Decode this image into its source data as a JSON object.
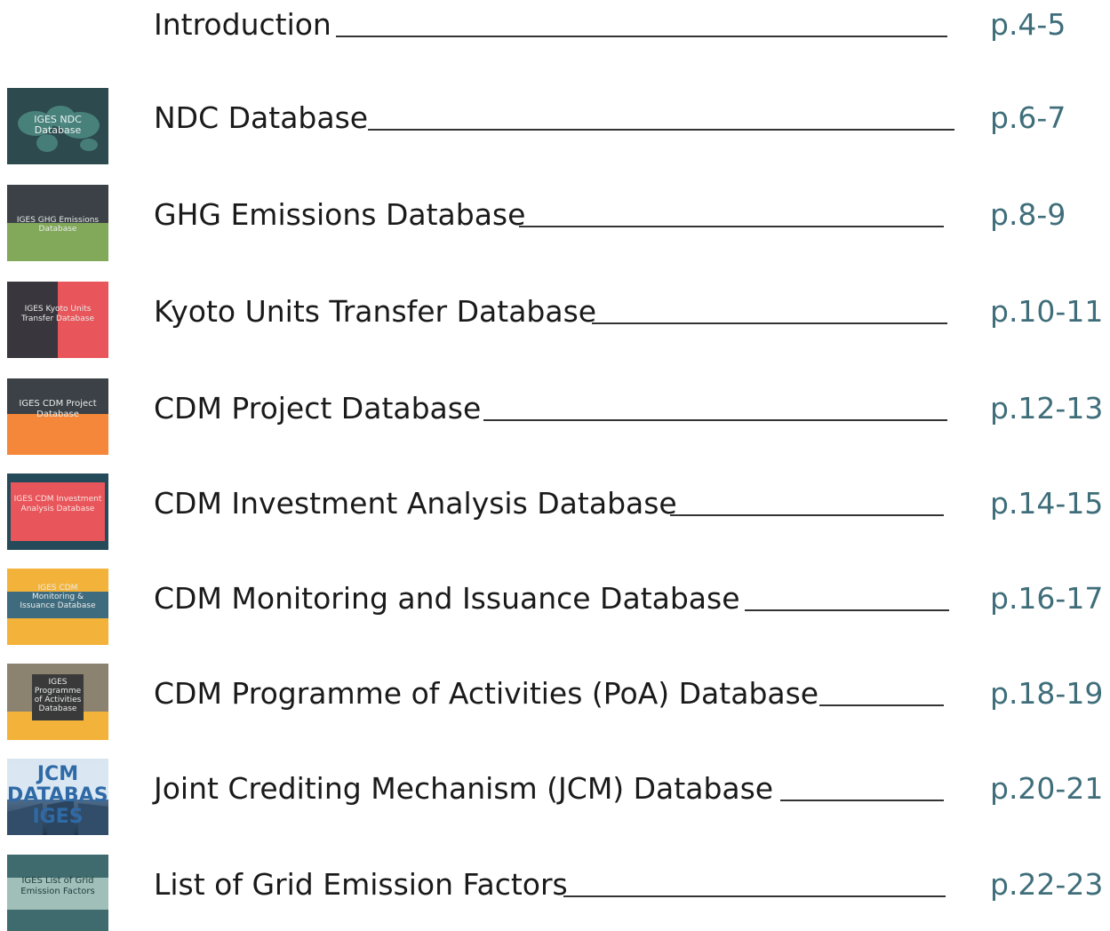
{
  "entries": [
    {
      "title": "Introduction",
      "page": "p.4-5"
    },
    {
      "title": "NDC Database",
      "page": "p.6-7",
      "thumb_text": "IGES NDC Database"
    },
    {
      "title": "GHG Emissions Database",
      "page": "p.8-9",
      "thumb_text": "IGES GHG Emissions Database"
    },
    {
      "title": "Kyoto Units Transfer Database",
      "page": "p.10-11",
      "thumb_text": "IGES Kyoto Units Transfer Database"
    },
    {
      "title": "CDM Project Database",
      "page": "p.12-13",
      "thumb_text": "IGES CDM Project Database"
    },
    {
      "title": "CDM Investment Analysis Database",
      "page": "p.14-15",
      "thumb_text": "IGES CDM Investment Analysis Database"
    },
    {
      "title": "CDM Monitoring and Issuance Database",
      "page": "p.16-17",
      "thumb_text": "IGES CDM Monitoring & Issuance Database"
    },
    {
      "title": "CDM Programme of Activities (PoA) Database",
      "page": "p.18-19",
      "thumb_text": "IGES Programme of Activities Database"
    },
    {
      "title": "Joint Crediting Mechanism (JCM) Database",
      "page": "p.20-21",
      "thumb_text": "JCM DATABASE IGES"
    },
    {
      "title": "List of Grid Emission Factors",
      "page": "p.22-23",
      "thumb_text": "IGES List of Grid Emission Factors"
    }
  ],
  "colors": {
    "page_number": "#3f6e7a",
    "title": "#1a1a1a"
  }
}
